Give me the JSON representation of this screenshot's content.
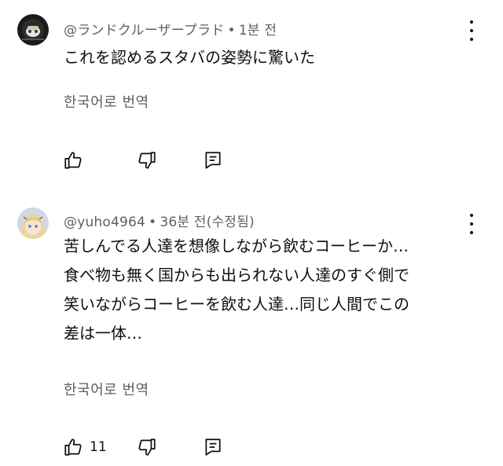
{
  "comments": [
    {
      "author": "@ランドクルーザープラド",
      "separator": "•",
      "time": "1분 전",
      "lines": [
        "これを認めるスタバの姿勢に驚いた"
      ],
      "translate_label": "한국어로 번역",
      "likes": "",
      "avatar_icon": "sticker-avatar-icon"
    },
    {
      "author": "@yuho4964",
      "separator": "•",
      "time": "36분 전(수정됨)",
      "lines": [
        "苦しんでる人達を想像しながら飲むコーヒーか…",
        "食べ物も無く国からも出られない人達のすぐ側で",
        "笑いながらコーヒーを飲む人達…同じ人間でこの",
        "差は一体…"
      ],
      "translate_label": "한국어로 번역",
      "likes": "11",
      "avatar_icon": "anime-avatar-icon"
    }
  ],
  "icons": {
    "like": "thumb-up-icon",
    "dislike": "thumb-down-icon",
    "reply": "reply-comment-icon",
    "menu": "more-vertical-icon"
  }
}
